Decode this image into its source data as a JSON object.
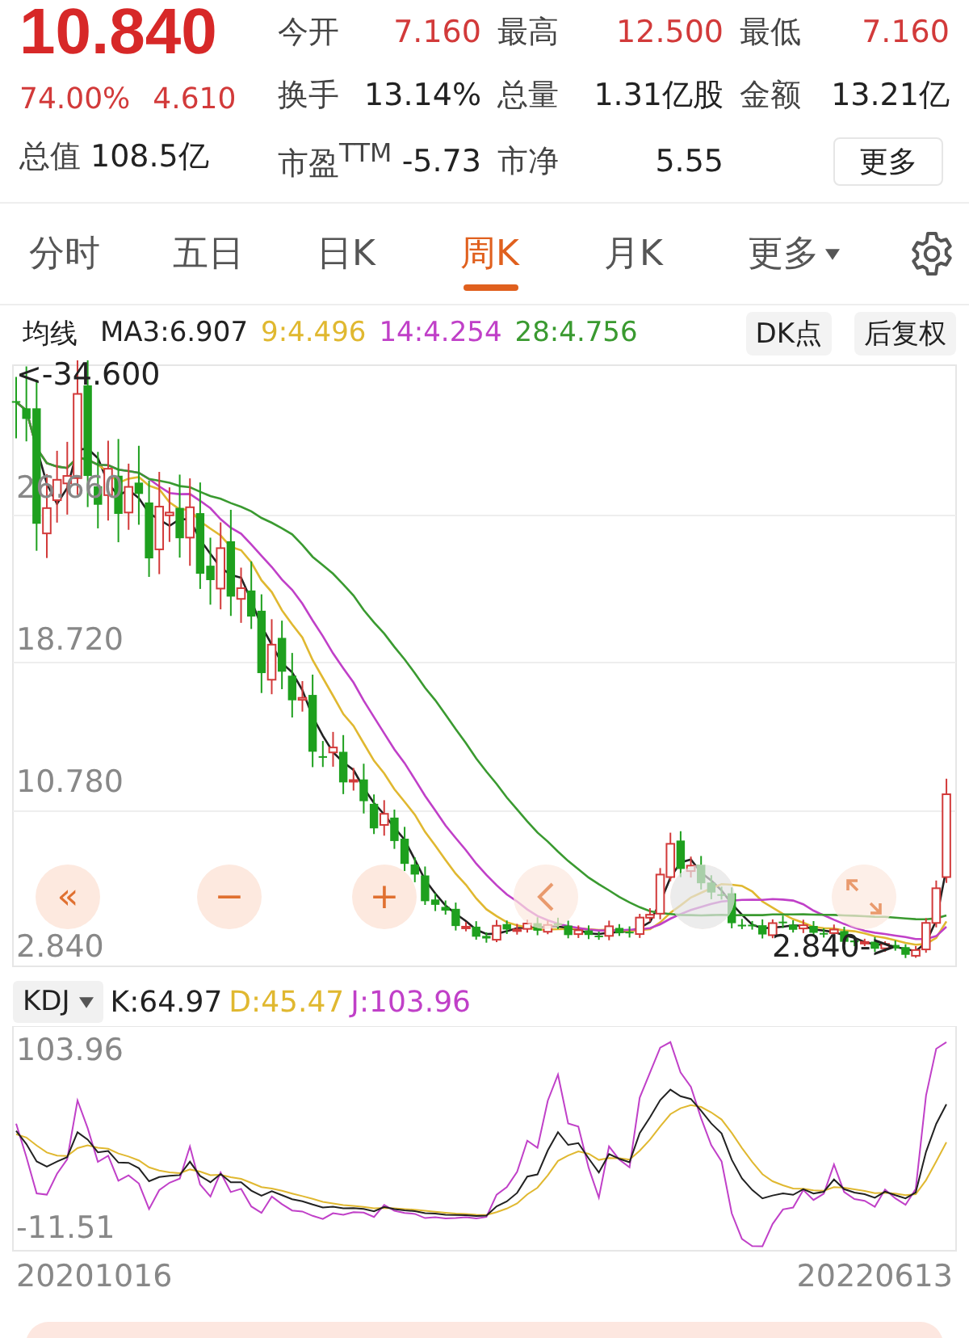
{
  "quote": {
    "price": "10.840",
    "change_pct": "74.00%",
    "change": "4.610"
  },
  "stats": [
    {
      "label": "今开",
      "value": "7.160",
      "kind": "up"
    },
    {
      "label": "最高",
      "value": "12.500",
      "kind": "up"
    },
    {
      "label": "最低",
      "value": "7.160",
      "kind": "up"
    },
    {
      "label": "换手",
      "value": "13.14%",
      "kind": "plain"
    },
    {
      "label": "总量",
      "value": "1.31亿股",
      "kind": "plain"
    },
    {
      "label": "金额",
      "value": "13.21亿",
      "kind": "plain"
    },
    {
      "label": "总值",
      "value": "108.5亿",
      "kind": "plain"
    },
    {
      "label": "市盈$^{TTM}$",
      "value": "-5.73",
      "kind": "plain"
    },
    {
      "label": "市净",
      "value": "5.55",
      "kind": "plain"
    }
  ],
  "more_button": "更多",
  "tabs": [
    {
      "label": "分时",
      "selected": false
    },
    {
      "label": "五日",
      "selected": false
    },
    {
      "label": "日K",
      "selected": false
    },
    {
      "label": "周K",
      "selected": true
    },
    {
      "label": "月K",
      "selected": false
    }
  ],
  "more_tab": "更多",
  "ma_bar": {
    "label": "均线",
    "items": [
      {
        "text": "MA3:6.907",
        "color": "#222222"
      },
      {
        "text": "9:4.496",
        "color": "#e0b830"
      },
      {
        "text": "14:4.254",
        "color": "#c040c8"
      },
      {
        "text": "28:4.756",
        "color": "#3a9a30"
      }
    ],
    "buttons": [
      "DK点",
      "后复权"
    ]
  },
  "main_chart": {
    "axis_labels": [
      "26.660",
      "18.720",
      "10.780",
      "2.840"
    ],
    "max_marker": "<-34.600",
    "min_marker": "2.840->"
  },
  "chart_controls": [
    {
      "kind": "text",
      "label": "«"
    },
    {
      "kind": "text",
      "label": "−"
    },
    {
      "kind": "text",
      "label": "+"
    },
    {
      "kind": "prev"
    },
    {
      "kind": "blank"
    },
    {
      "kind": "expand"
    }
  ],
  "indicator": {
    "name": "KDJ",
    "values": [
      {
        "text": "K:64.97",
        "color": "#222222"
      },
      {
        "text": "D:45.47",
        "color": "#e0b830"
      },
      {
        "text": "J:103.96",
        "color": "#c040c8"
      }
    ],
    "top_label": "103.96",
    "bottom_label": "-11.51"
  },
  "dates": [
    "20201016",
    "20220613"
  ]
}
